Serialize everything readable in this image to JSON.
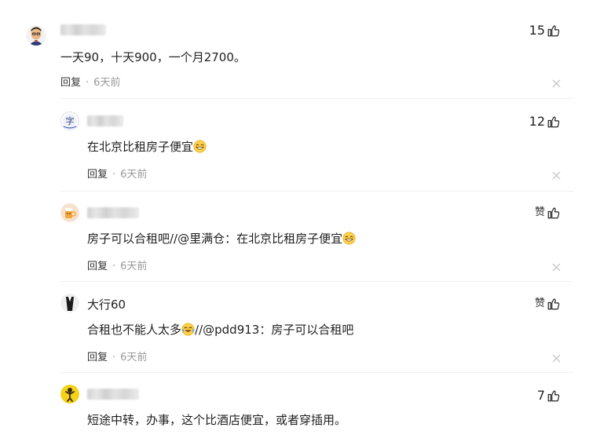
{
  "comments": [
    {
      "avatar": "man-portrait-avatar",
      "likes": "15",
      "text": "一天90，十天900，一个月2700。",
      "reply_label": "回复",
      "time": "6天前",
      "close_icon": "close-icon"
    },
    {
      "avatar": "character-badge-avatar",
      "likes": "12",
      "text": "在北京比租房子便宜",
      "emoji": "grinning-face-emoji",
      "reply_label": "回复",
      "time": "6天前"
    },
    {
      "avatar": "cartoon-beer-avatar",
      "like_label": "赞",
      "text": "房子可以合租吧//@里满仓：在北京比租房子便宜",
      "emoji": "grinning-face-emoji",
      "reply_label": "回复",
      "time": "6天前"
    },
    {
      "avatar": "black-figure-avatar",
      "username": "大行60",
      "like_label": "赞",
      "text_before": "合租也不能人太多",
      "emoji": "crying-laughing-emoji",
      "text_after": "//@pdd913：房子可以合租吧",
      "reply_label": "回复",
      "time": "6天前"
    },
    {
      "avatar": "yellow-figure-avatar",
      "likes": "7",
      "text": "短途中转，办事，这个比酒店便宜，或者穿插用。"
    }
  ],
  "colors": {
    "text": "#222222",
    "muted": "#999999",
    "divider": "#efefef"
  }
}
